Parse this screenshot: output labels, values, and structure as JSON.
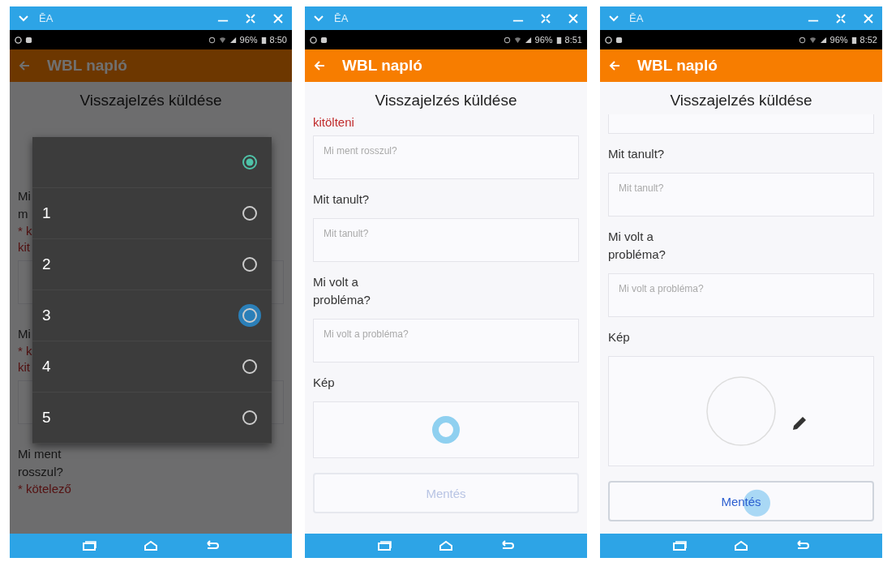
{
  "panels": [
    {
      "window_bar": {
        "title": "ĒA"
      },
      "status_bar": {
        "battery": "96%",
        "time": "8:50"
      },
      "app_bar": {
        "title": "WBL napló"
      },
      "heading": "Visszajelzés küldése",
      "backdrop_groups": [
        {
          "lines": [
            "Mi",
            "m"
          ],
          "required": [
            "* k",
            "kit"
          ],
          "field": true
        },
        {
          "lines": [
            "Mi"
          ],
          "required": [
            "* k",
            "kit"
          ],
          "field": true
        },
        {
          "lines": [
            "Mi ment",
            "rosszul?"
          ],
          "required": [
            "* kötelező"
          ],
          "field": false
        }
      ],
      "dialog": {
        "options": [
          {
            "selected": true,
            "focused": false
          },
          {
            "label": "1",
            "selected": false,
            "focused": false
          },
          {
            "label": "2",
            "selected": false,
            "focused": false
          },
          {
            "label": "3",
            "selected": false,
            "focused": true
          },
          {
            "label": "4",
            "selected": false,
            "focused": false
          },
          {
            "label": "5",
            "selected": false,
            "focused": false
          }
        ]
      }
    },
    {
      "window_bar": {
        "title": "ĒA"
      },
      "status_bar": {
        "battery": "96%",
        "time": "8:51"
      },
      "app_bar": {
        "title": "WBL napló"
      },
      "heading": "Visszajelzés küldése",
      "content": [
        {
          "kind": "required",
          "text": "kitölteni"
        },
        {
          "kind": "field",
          "placeholder": "Mi ment rosszul?"
        },
        {
          "kind": "label",
          "text": "Mit tanult?"
        },
        {
          "kind": "field",
          "placeholder": "Mit tanult?"
        },
        {
          "kind": "label",
          "text": "Mi volt a probléma?"
        },
        {
          "kind": "field",
          "placeholder": "Mi volt a probléma?"
        },
        {
          "kind": "label",
          "text": "Kép"
        },
        {
          "kind": "image",
          "loading": true
        },
        {
          "kind": "button",
          "label": "Mentés",
          "disabled": true,
          "pressed": false
        }
      ]
    },
    {
      "window_bar": {
        "title": "ĒA"
      },
      "status_bar": {
        "battery": "96%",
        "time": "8:52"
      },
      "app_bar": {
        "title": "WBL napló"
      },
      "heading": "Visszajelzés küldése",
      "content": [
        {
          "kind": "field",
          "cut_top": true
        },
        {
          "kind": "label",
          "text": "Mit tanult?"
        },
        {
          "kind": "field",
          "placeholder": "Mit tanult?"
        },
        {
          "kind": "label",
          "text": "Mi volt a probléma?"
        },
        {
          "kind": "field",
          "placeholder": "Mi volt a probléma?"
        },
        {
          "kind": "label",
          "text": "Kép"
        },
        {
          "kind": "image",
          "loading": false
        },
        {
          "kind": "button",
          "label": "Mentés",
          "disabled": false,
          "pressed": true
        }
      ]
    }
  ]
}
